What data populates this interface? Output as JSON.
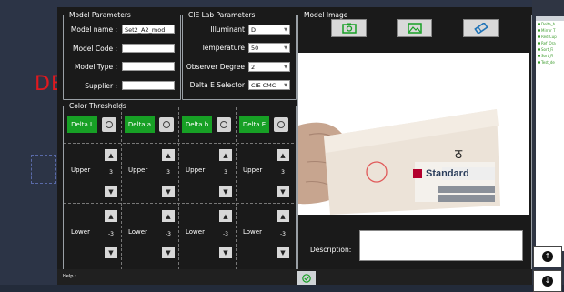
{
  "background": {
    "title_fragment": "DE",
    "accent_color": "#e0191f"
  },
  "right_panel": {
    "items": [
      "Delta_b",
      "Mirror T",
      "Red Cup",
      "Ref_Ora",
      "Sort_Fi",
      "Sort_Fi",
      "Test_de"
    ],
    "button1_icon": "arrow-up-icon",
    "button2_icon": "arrow-down-icon"
  },
  "model_parameters": {
    "legend": "Model Parameters",
    "name_label": "Model name :",
    "name_value": "Set2_A2_mod",
    "code_label": "Model Code :",
    "code_value": "",
    "type_label": "Model Type :",
    "type_value": "",
    "supplier_label": "Supplier :",
    "supplier_value": ""
  },
  "cielab": {
    "legend": "CIE Lab Parameters",
    "illuminant_label": "Illuminant",
    "illuminant_value": "D",
    "temperature_label": "Temperature",
    "temperature_value": "50",
    "observer_label": "Observer Degree",
    "observer_value": "2",
    "delta_label": "Delta E Selector",
    "delta_value": "CIE CMC"
  },
  "thresholds": {
    "legend": "Color Thresholds",
    "columns": [
      {
        "button": "Delta L",
        "upper_label": "Upper",
        "upper_value": "3",
        "lower_label": "Lower",
        "lower_value": "-3"
      },
      {
        "button": "Delta a",
        "upper_label": "Upper",
        "upper_value": "3",
        "lower_label": "Lower",
        "lower_value": "-3"
      },
      {
        "button": "Delta b",
        "upper_label": "Upper",
        "upper_value": "3",
        "lower_label": "Lower",
        "lower_value": "-3"
      },
      {
        "button": "Delta E",
        "upper_label": "Upper",
        "upper_value": "3",
        "lower_label": "Lower",
        "lower_value": "-3"
      }
    ]
  },
  "model_image": {
    "legend": "Model Image",
    "label_text_brand": "Standard",
    "label_glyph": "ठ",
    "description_label": "Description:",
    "description_value": ""
  },
  "footer": {
    "help": "Help :"
  },
  "colors": {
    "green": "#17a025",
    "dialog_bg": "#1a1a1a"
  }
}
